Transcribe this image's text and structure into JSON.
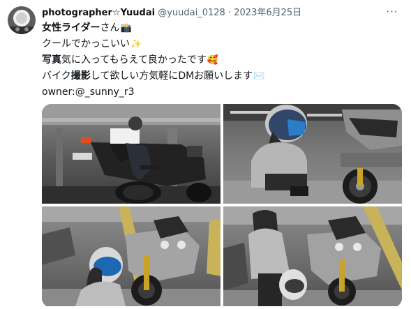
{
  "tweet": {
    "display_name": "photographer☆Yuudai",
    "handle": "@yuudai_0128",
    "separator": "·",
    "date": "2023年6月25日",
    "more_label": "···",
    "lines": {
      "l1_bold": "女性ライダー",
      "l1_rest": "さん",
      "l1_emoji": "📸",
      "l2": "クールでかっこいい",
      "l2_emoji": "✨",
      "l3_bold": "写真",
      "l3_rest": "気に入ってもらえて良かったです",
      "l3_emoji": "🥰",
      "l4_pre": "バイク",
      "l4_bold": "撮影",
      "l4_rest": "して欲しい方気軽にDMお願いします",
      "l4_emoji": "✉️",
      "l5": "owner:@_sunny_r3"
    }
  },
  "colors": {
    "text": "#0f1419",
    "muted": "#536471"
  },
  "photos": [
    {
      "id": "photo-rider-on-bike-rear",
      "icon": "photo-rider-on-bike"
    },
    {
      "id": "photo-rider-crouch-helmet",
      "icon": "photo-rider-crouching"
    },
    {
      "id": "photo-rider-holding-helmet",
      "icon": "photo-rider-helmet"
    },
    {
      "id": "photo-rider-standing-bike",
      "icon": "photo-rider-standing"
    }
  ]
}
